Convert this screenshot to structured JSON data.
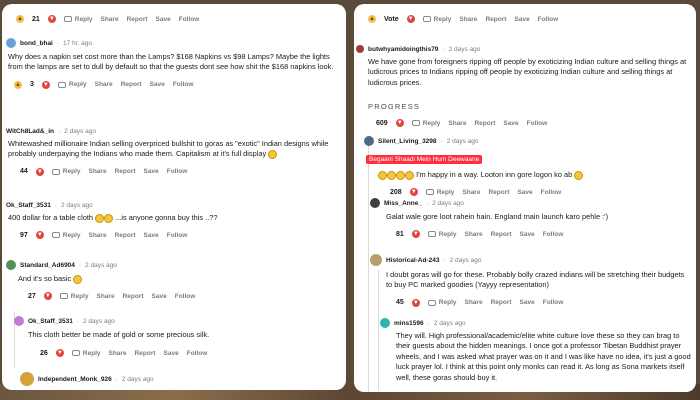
{
  "left": {
    "top_votes": "21",
    "comments": [
      {
        "user": "bond_bhai",
        "time": "17 hr. ago",
        "text": "Why does a napkin set cost more than the Lamps? $168 Napkins vs $98 Lamps? Maybe the lights from the lamps are set to dull by default so that the guests dont see how shit the $168 napkins look.",
        "votes": "3"
      },
      {
        "user": "WitCh8Lad&_in",
        "time": "2 days ago",
        "text": "Whitewashed millionaire Indian selling overpriced bullshit to goras as \"exotic\" Indian designs while probably underpaying the Indians who made them. Capitalism at it's full display",
        "votes": "44"
      },
      {
        "user": "Ok_Staff_3531",
        "time": "2 days ago",
        "text": "400 dollar for a table cloth",
        "text2": "...is anyone gonna buy this ..??",
        "votes": "97"
      },
      {
        "user": "Standard_Ad6904",
        "time": "2 days ago",
        "text": "And it's so basic",
        "votes": "27"
      },
      {
        "user": "Ok_Staff_3531",
        "time": "2 days ago",
        "text": "This cloth better be made of gold or some precious silk.",
        "votes": "26"
      },
      {
        "user": "Independent_Monk_926",
        "time": "2 days ago"
      }
    ]
  },
  "right": {
    "top_vote_label": "Vote",
    "progress": "PROGRESS",
    "comments": [
      {
        "user": "butwhyamidoingthis79",
        "time": "2 days ago",
        "text": "We have gone from foreigners ripping off people by exoticizing Indian culture and selling things at ludicrous prices to Indians ripping off people by exoticizing Indian culture and selling things at ludicrous prices.",
        "votes": "609"
      },
      {
        "user": "Silent_Living_3298",
        "time": "2 days ago",
        "flair": "Begaani Shaadi Mein Hum Deewaane",
        "text": "I'm happy in a way. Looton inn gore logon ko ab",
        "votes": "208"
      },
      {
        "user": "Miss_Anne_",
        "time": "2 days ago",
        "text": "Galat wale gore loot rahein hain. England main launch karo pehle :')",
        "votes": "81"
      },
      {
        "user": "Historical-Ad-243",
        "time": "2 days ago",
        "text": "I doubt goras will go for these. Probably bolly crazed indians will be stretching their budgets to buy PC marked goodies (Yayyy representation)",
        "votes": "45"
      },
      {
        "user": "mins1596",
        "time": "2 days ago",
        "text": "They will. High professional/academic/elite white culture love these so they can brag to their guests about the hidden meanings. I once got a professor Tibetan Buddhist prayer wheels, and I was asked what prayer was on it and I was like have no idea, it's just a good luck prayer lol. I think at this point only monks can read it. As long as Sona markets itself well, these goras should buy it."
      }
    ]
  },
  "actions": {
    "reply": "Reply",
    "share": "Share",
    "report": "Report",
    "save": "Save",
    "follow": "Follow"
  },
  "colors": {
    "upvote": "#f2c14e",
    "downvote": "#e0463f",
    "flair": "#ff2f3e"
  }
}
